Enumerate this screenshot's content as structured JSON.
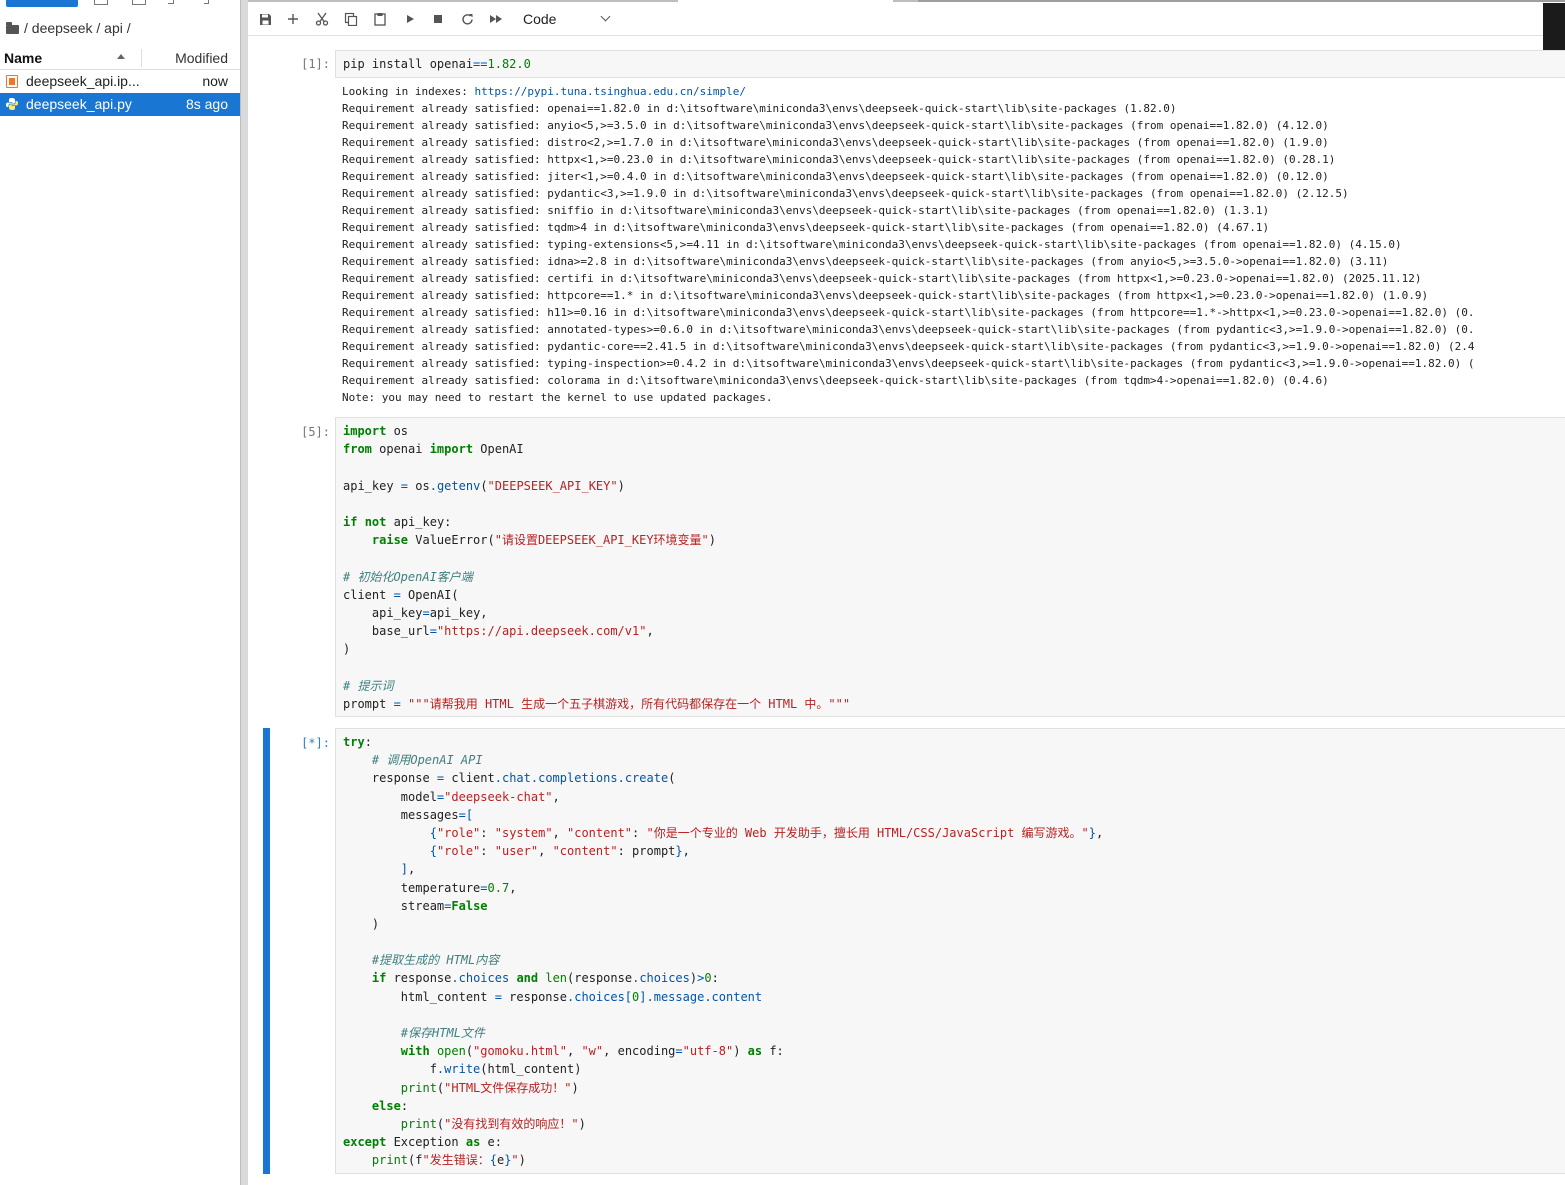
{
  "file_browser": {
    "breadcrumb": "/ deepseek / api /",
    "columns": {
      "name": "Name",
      "modified": "Modified"
    },
    "files": [
      {
        "name": "deepseek_api.ip...",
        "modified": "now",
        "type": "notebook",
        "selected": false
      },
      {
        "name": "deepseek_api.py",
        "modified": "8s ago",
        "type": "python",
        "selected": true
      }
    ]
  },
  "toolbar": {
    "buttons": [
      "save-icon",
      "add-icon",
      "cut-icon",
      "copy-icon",
      "paste-icon",
      "run-icon",
      "stop-icon",
      "restart-icon",
      "fast-forward-icon"
    ],
    "cell_type": "Code"
  },
  "colors": {
    "accent": "#1976d2",
    "keyword": "#008000",
    "string": "#ba2121",
    "comment": "#408080"
  },
  "cells": [
    {
      "prompt": "[1]:",
      "input": "pip install openai==1.82.0",
      "output": [
        "Looking in indexes: https://pypi.tuna.tsinghua.edu.cn/simple/",
        "Requirement already satisfied: openai==1.82.0 in d:\\itsoftware\\miniconda3\\envs\\deepseek-quick-start\\lib\\site-packages (1.82.0)",
        "Requirement already satisfied: anyio<5,>=3.5.0 in d:\\itsoftware\\miniconda3\\envs\\deepseek-quick-start\\lib\\site-packages (from openai==1.82.0) (4.12.0)",
        "Requirement already satisfied: distro<2,>=1.7.0 in d:\\itsoftware\\miniconda3\\envs\\deepseek-quick-start\\lib\\site-packages (from openai==1.82.0) (1.9.0)",
        "Requirement already satisfied: httpx<1,>=0.23.0 in d:\\itsoftware\\miniconda3\\envs\\deepseek-quick-start\\lib\\site-packages (from openai==1.82.0) (0.28.1)",
        "Requirement already satisfied: jiter<1,>=0.4.0 in d:\\itsoftware\\miniconda3\\envs\\deepseek-quick-start\\lib\\site-packages (from openai==1.82.0) (0.12.0)",
        "Requirement already satisfied: pydantic<3,>=1.9.0 in d:\\itsoftware\\miniconda3\\envs\\deepseek-quick-start\\lib\\site-packages (from openai==1.82.0) (2.12.5)",
        "Requirement already satisfied: sniffio in d:\\itsoftware\\miniconda3\\envs\\deepseek-quick-start\\lib\\site-packages (from openai==1.82.0) (1.3.1)",
        "Requirement already satisfied: tqdm>4 in d:\\itsoftware\\miniconda3\\envs\\deepseek-quick-start\\lib\\site-packages (from openai==1.82.0) (4.67.1)",
        "Requirement already satisfied: typing-extensions<5,>=4.11 in d:\\itsoftware\\miniconda3\\envs\\deepseek-quick-start\\lib\\site-packages (from openai==1.82.0) (4.15.0)",
        "Requirement already satisfied: idna>=2.8 in d:\\itsoftware\\miniconda3\\envs\\deepseek-quick-start\\lib\\site-packages (from anyio<5,>=3.5.0->openai==1.82.0) (3.11)",
        "Requirement already satisfied: certifi in d:\\itsoftware\\miniconda3\\envs\\deepseek-quick-start\\lib\\site-packages (from httpx<1,>=0.23.0->openai==1.82.0) (2025.11.12)",
        "Requirement already satisfied: httpcore==1.* in d:\\itsoftware\\miniconda3\\envs\\deepseek-quick-start\\lib\\site-packages (from httpx<1,>=0.23.0->openai==1.82.0) (1.0.9)",
        "Requirement already satisfied: h11>=0.16 in d:\\itsoftware\\miniconda3\\envs\\deepseek-quick-start\\lib\\site-packages (from httpcore==1.*->httpx<1,>=0.23.0->openai==1.82.0) (0.",
        "Requirement already satisfied: annotated-types>=0.6.0 in d:\\itsoftware\\miniconda3\\envs\\deepseek-quick-start\\lib\\site-packages (from pydantic<3,>=1.9.0->openai==1.82.0) (0.",
        "Requirement already satisfied: pydantic-core==2.41.5 in d:\\itsoftware\\miniconda3\\envs\\deepseek-quick-start\\lib\\site-packages (from pydantic<3,>=1.9.0->openai==1.82.0) (2.4",
        "Requirement already satisfied: typing-inspection>=0.4.2 in d:\\itsoftware\\miniconda3\\envs\\deepseek-quick-start\\lib\\site-packages (from pydantic<3,>=1.9.0->openai==1.82.0) (",
        "Requirement already satisfied: colorama in d:\\itsoftware\\miniconda3\\envs\\deepseek-quick-start\\lib\\site-packages (from tqdm>4->openai==1.82.0) (0.4.6)",
        "Note: you may need to restart the kernel to use updated packages."
      ]
    },
    {
      "prompt": "[5]:",
      "input_lines": [
        "import os",
        "from openai import OpenAI",
        "",
        "api_key = os.getenv(\"DEEPSEEK_API_KEY\")",
        "",
        "if not api_key:",
        "    raise ValueError(\"请设置DEEPSEEK_API_KEY环境变量\")",
        "",
        "# 初始化OpenAI客户端",
        "client = OpenAI(",
        "    api_key=api_key,",
        "    base_url=\"https://api.deepseek.com/v1\",",
        ")",
        "",
        "# 提示词",
        "prompt = \"\"\"请帮我用 HTML 生成一个五子棋游戏，所有代码都保存在一个 HTML 中。\"\"\""
      ]
    },
    {
      "prompt": "[*]:",
      "input_lines": [
        "try:",
        "    # 调用OpenAI API",
        "    response = client.chat.completions.create(",
        "        model=\"deepseek-chat\",",
        "        messages=[",
        "            {\"role\": \"system\", \"content\": \"你是一个专业的 Web 开发助手，擅长用 HTML/CSS/JavaScript 编写游戏。\"},",
        "            {\"role\": \"user\", \"content\": prompt},",
        "        ],",
        "        temperature=0.7,",
        "        stream=False",
        "    )",
        "",
        "    #提取生成的 HTML内容",
        "    if response.choices and len(response.choices)>0:",
        "        html_content = response.choices[0].message.content",
        "",
        "        #保存HTML文件",
        "        with open(\"gomoku.html\", \"w\", encoding=\"utf-8\") as f:",
        "            f.write(html_content)",
        "        print(\"HTML文件保存成功！\")",
        "    else:",
        "        print(\"没有找到有效的响应！\")",
        "except Exception as e:",
        "    print(f\"发生错误：{e}\")"
      ]
    }
  ]
}
